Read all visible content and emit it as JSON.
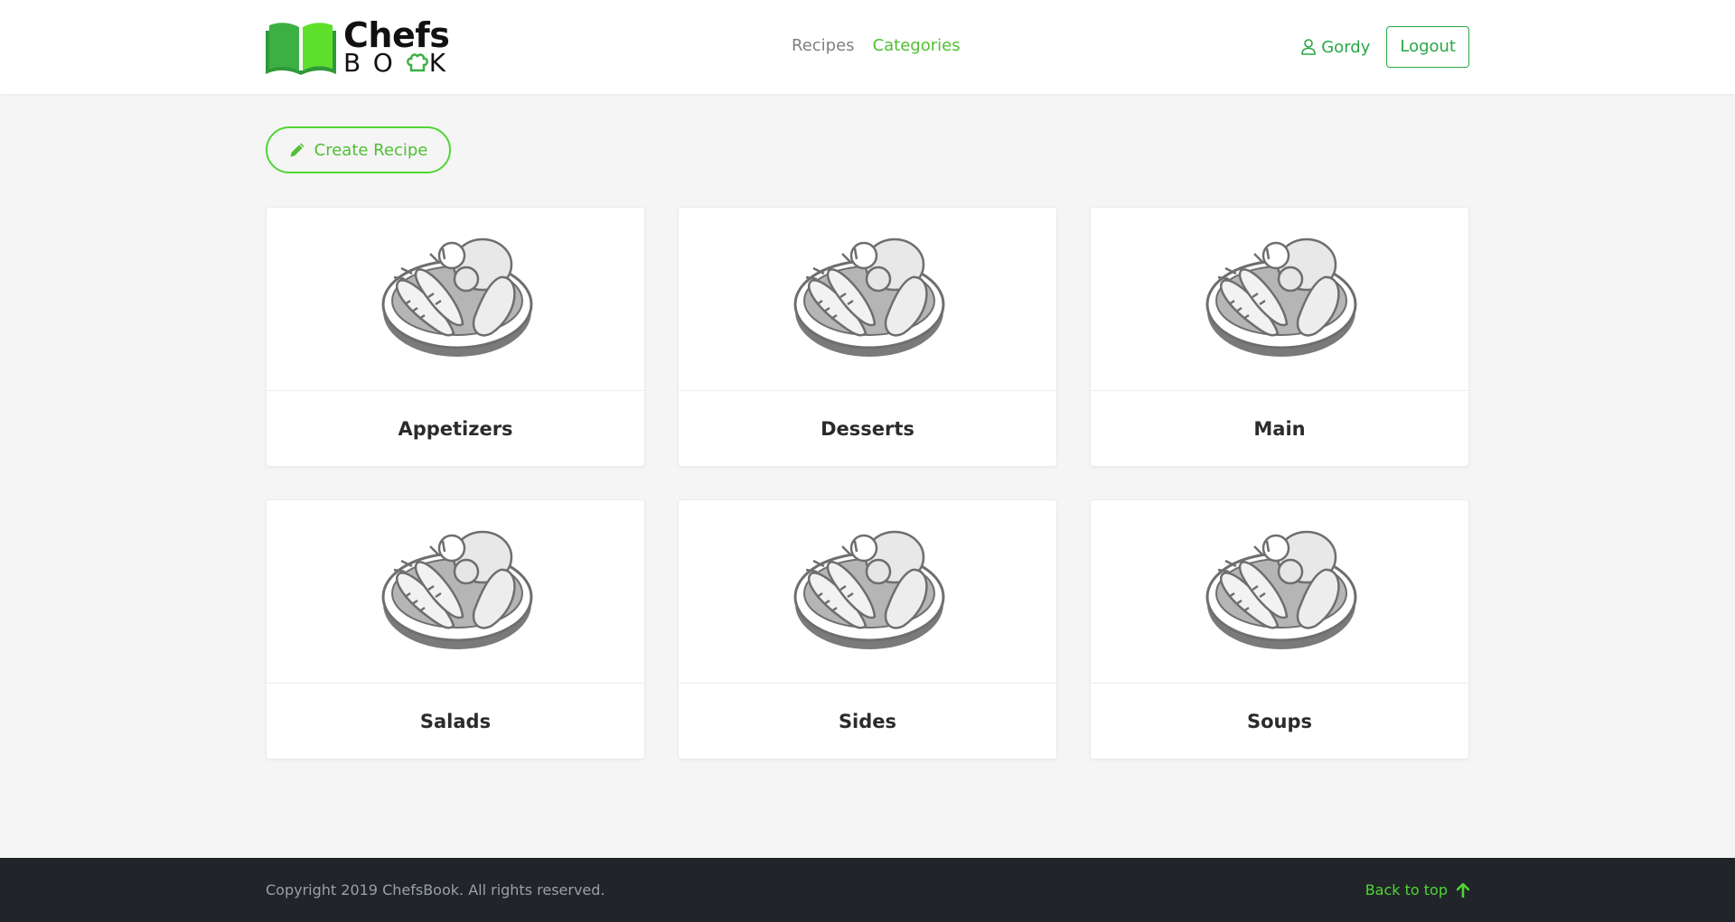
{
  "brand": {
    "name_top": "Chefs",
    "name_bottom_left": "BO",
    "name_bottom_right": "K",
    "colors": {
      "green_dark": "#3cb043",
      "green_light": "#5ee02b"
    }
  },
  "nav": {
    "links": [
      {
        "label": "Recipes",
        "active": false
      },
      {
        "label": "Categories",
        "active": true
      }
    ],
    "user": {
      "name": "Gordy",
      "icon": "user-icon"
    },
    "logout_label": "Logout"
  },
  "actions": {
    "create_label": "Create Recipe",
    "create_icon": "pencil-icon"
  },
  "categories": [
    {
      "name": "Appetizers"
    },
    {
      "name": "Desserts"
    },
    {
      "name": "Main"
    },
    {
      "name": "Salads"
    },
    {
      "name": "Sides"
    },
    {
      "name": "Soups"
    }
  ],
  "footer": {
    "copyright": "Copyright 2019 ChefsBook. All rights reserved.",
    "back_to_top": "Back to top",
    "back_icon": "arrow-up-icon"
  },
  "colors": {
    "accent": "#4fd633",
    "accent_text": "#4fbf33",
    "link_green": "#28a745",
    "footer_bg": "#212529",
    "page_bg": "#f5f5f5"
  }
}
